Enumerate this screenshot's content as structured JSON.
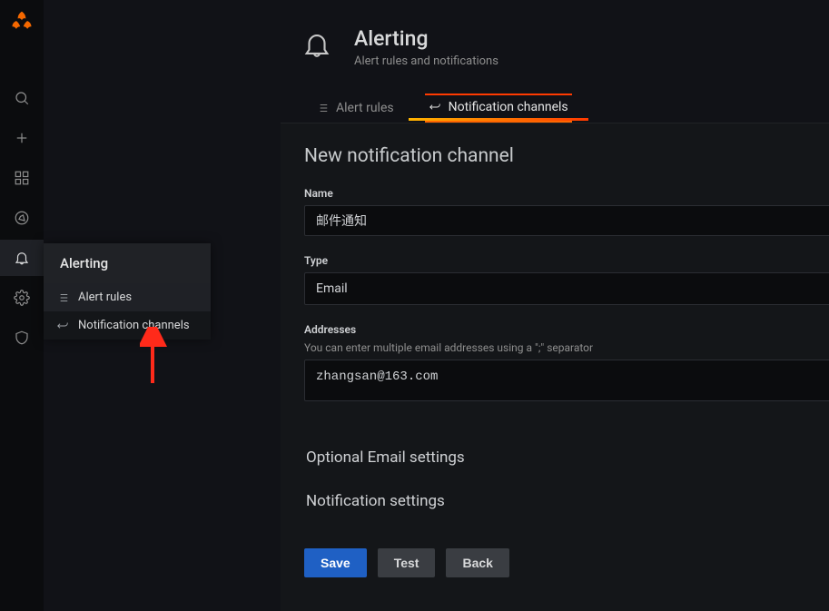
{
  "sidebar": {
    "flyout_title": "Alerting",
    "items": [
      {
        "label": "Alert rules"
      },
      {
        "label": "Notification channels"
      }
    ]
  },
  "header": {
    "title": "Alerting",
    "subtitle": "Alert rules and notifications"
  },
  "tabs": {
    "alert_rules": "Alert rules",
    "notification_channels": "Notification channels"
  },
  "form": {
    "title": "New notification channel",
    "name_label": "Name",
    "name_value": "邮件通知",
    "type_label": "Type",
    "type_value": "Email",
    "addresses_label": "Addresses",
    "addresses_help": "You can enter multiple email addresses using a \";\" separator",
    "addresses_value": "zhangsan@163.com",
    "optional_email_settings": "Optional Email settings",
    "notification_settings": "Notification settings"
  },
  "buttons": {
    "save": "Save",
    "test": "Test",
    "back": "Back"
  }
}
